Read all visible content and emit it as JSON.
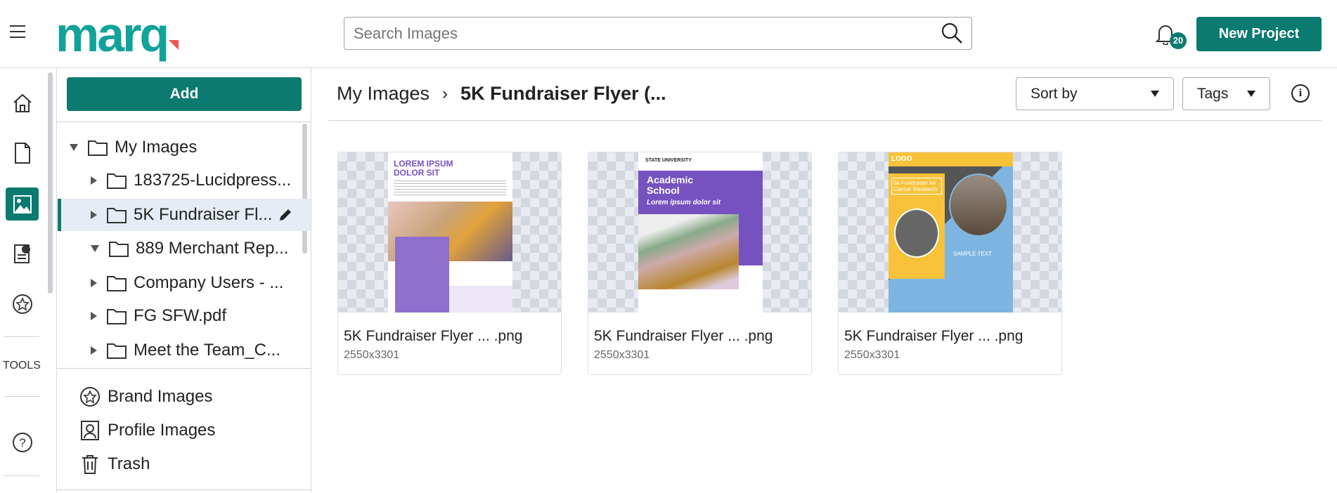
{
  "header": {
    "logo": "marq",
    "search_placeholder": "Search Images",
    "notification_count": "20",
    "new_project_label": "New Project"
  },
  "rail": {
    "items": [
      {
        "icon": "home-icon"
      },
      {
        "icon": "document-icon"
      },
      {
        "icon": "image-icon",
        "active": true
      },
      {
        "icon": "brand-template-icon"
      },
      {
        "icon": "star-icon"
      }
    ],
    "tools_label": "TOOLS",
    "help_icon": "help-icon"
  },
  "panel": {
    "add_label": "Add",
    "tree": {
      "root": "My Images",
      "children": [
        {
          "label": "183725-Lucidpress..."
        },
        {
          "label": "5K Fundraiser Fl...",
          "selected": true
        },
        {
          "label": "889 Merchant Rep..."
        },
        {
          "label": "Company Users - ..."
        },
        {
          "label": "FG SFW.pdf"
        },
        {
          "label": "Meet the Team_C..."
        }
      ]
    },
    "links": [
      {
        "label": "Brand Images",
        "icon": "star-icon"
      },
      {
        "label": "Profile Images",
        "icon": "profile-icon"
      },
      {
        "label": "Trash",
        "icon": "trash-icon"
      }
    ]
  },
  "main": {
    "breadcrumb": {
      "root": "My Images",
      "current": "5K Fundraiser Flyer (..."
    },
    "sort_label": "Sort by",
    "tags_label": "Tags",
    "info_icon": "i",
    "cards": [
      {
        "title": "5K Fundraiser Flyer ... .png",
        "dims": "2550x3301",
        "flyer_heading": "LOREM IPSUM DOLOR SIT"
      },
      {
        "title": "5K Fundraiser Flyer ... .png",
        "dims": "2550x3301",
        "flyer_brand": "STATE UNIVERSITY",
        "flyer_heading": "Academic School",
        "flyer_sub": "Lorem ipsum dolor sit"
      },
      {
        "title": "5K Fundraiser Flyer ... .png",
        "dims": "2550x3301",
        "flyer_logo": "LOGO",
        "flyer_heading": "5k Fundraiser for Cancer Research",
        "flyer_sample": "SAMPLE TEXT"
      }
    ]
  },
  "colors": {
    "brand": "#0b7a70",
    "logo": "#11a39a",
    "accent": "#f05458",
    "purple": "#7652c0"
  }
}
